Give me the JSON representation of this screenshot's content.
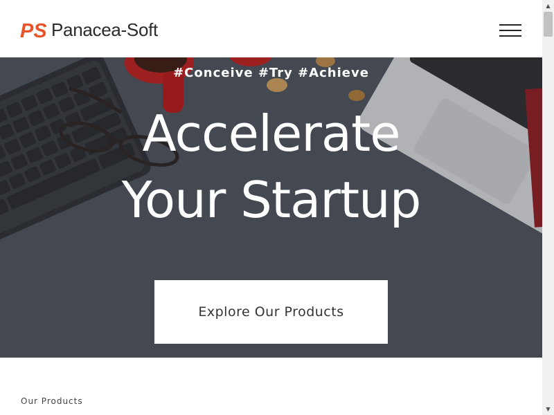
{
  "header": {
    "logo_mark": "PS",
    "logo_text": "Panacea-Soft",
    "brand_color": "#e8542a",
    "menu_icon": "hamburger-menu-icon"
  },
  "hero": {
    "tagline": "#Conceive #Try #Achieve",
    "title_line1": "Accelerate",
    "title_line2": "Your Startup",
    "cta_label": "Explore Our Products"
  },
  "products": {
    "section_label": "Our Products"
  },
  "scrollbar": {
    "up_icon": "scroll-up-arrow-icon",
    "down_icon": "scroll-down-arrow-icon"
  }
}
